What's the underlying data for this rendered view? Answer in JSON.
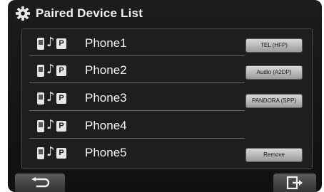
{
  "header": {
    "title": "Paired Device List",
    "icon": "gear-icon"
  },
  "devices": [
    {
      "name": "Phone1",
      "button": "TEL (HFP)"
    },
    {
      "name": "Phone2",
      "button": "Audio (A2DP)"
    },
    {
      "name": "Phone3",
      "button": "PANDORA (SPP)"
    },
    {
      "name": "Phone4",
      "button": ""
    },
    {
      "name": "Phone5",
      "button": "Remove"
    }
  ],
  "device_icons": {
    "phone": "phone-icon",
    "audio": "music-note-icon",
    "profile": "P"
  },
  "footer": {
    "back_icon": "back-arrow-icon",
    "exit_icon": "exit-icon"
  },
  "colors": {
    "background": "#121212",
    "text": "#f2f2f2",
    "button": "#c4c4c4"
  }
}
